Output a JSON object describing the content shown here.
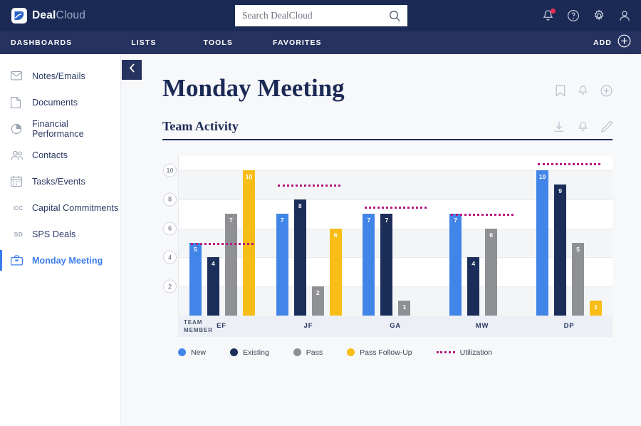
{
  "brand": {
    "deal": "Deal",
    "cloud": "Cloud",
    "logo_icon": "dealcloud-logo-icon"
  },
  "search": {
    "placeholder": "Search DealCloud",
    "value": "",
    "icon": "search-icon"
  },
  "top_icons": [
    {
      "name": "notifications-bell-icon",
      "has_badge": true
    },
    {
      "name": "help-circle-icon",
      "has_badge": false
    },
    {
      "name": "settings-gear-icon",
      "has_badge": false
    },
    {
      "name": "user-profile-icon",
      "has_badge": false
    }
  ],
  "nav": {
    "items": [
      {
        "label": "DASHBOARDS"
      },
      {
        "label": "LISTS"
      },
      {
        "label": "TOOLS"
      },
      {
        "label": "FAVORITES"
      }
    ],
    "add_label": "ADD",
    "add_icon": "plus-circle-icon"
  },
  "sidebar": {
    "collapse_icon": "chevron-left-icon",
    "items": [
      {
        "label": "Notes/Emails",
        "icon": "envelope-icon",
        "active": false
      },
      {
        "label": "Documents",
        "icon": "document-icon",
        "active": false
      },
      {
        "label": "Financial Performance",
        "icon": "pie-chart-icon",
        "active": false
      },
      {
        "label": "Contacts",
        "icon": "contacts-icon",
        "active": false
      },
      {
        "label": "Tasks/Events",
        "icon": "calendar-icon",
        "active": false
      },
      {
        "label": "Capital Commitments",
        "icon": "cc-text-icon",
        "mono": "CC",
        "active": false
      },
      {
        "label": "SPS Deals",
        "icon": "sd-text-icon",
        "mono": "SD",
        "active": false
      },
      {
        "label": "Monday Meeting",
        "icon": "briefcase-icon",
        "active": true
      }
    ]
  },
  "page": {
    "title": "Monday Meeting",
    "title_icons": [
      {
        "name": "bookmark-icon"
      },
      {
        "name": "bell-icon"
      },
      {
        "name": "plus-circle-icon"
      }
    ]
  },
  "card": {
    "title": "Team Activity",
    "icons": [
      {
        "name": "download-icon"
      },
      {
        "name": "bell-icon"
      },
      {
        "name": "edit-pencil-icon"
      }
    ]
  },
  "colors": {
    "new": "#4285e8",
    "existing": "#1b2e5a",
    "pass": "#8e9094",
    "pass_follow_up": "#f9bd18",
    "utilization": "#b5187f",
    "navy": "#1b2a55",
    "accent": "#3b7ded"
  },
  "chart_data": {
    "type": "bar",
    "title": "Team Activity",
    "xlabel": "TEAM MEMBER",
    "ylabel": "",
    "ylim": [
      0,
      11
    ],
    "yticks": [
      2,
      4,
      6,
      8,
      10
    ],
    "grid": true,
    "legend_position": "bottom",
    "categories": [
      "EF",
      "JF",
      "GA",
      "MW",
      "DP"
    ],
    "series": [
      {
        "name": "New",
        "color": "#4285e8",
        "values": [
          5,
          7,
          7,
          7,
          10
        ]
      },
      {
        "name": "Existing",
        "color": "#1b2e5a",
        "values": [
          4,
          8,
          7,
          4,
          9
        ]
      },
      {
        "name": "Pass",
        "color": "#8e9094",
        "values": [
          7,
          2,
          1,
          6,
          5
        ]
      },
      {
        "name": "Pass Follow-Up",
        "color": "#f9bd18",
        "values": [
          10,
          6,
          null,
          null,
          1
        ]
      }
    ],
    "overlay": {
      "name": "Utilization",
      "type": "dotted-line",
      "color": "#b5187f",
      "values": [
        5,
        9,
        7.5,
        7,
        10.5
      ]
    }
  }
}
